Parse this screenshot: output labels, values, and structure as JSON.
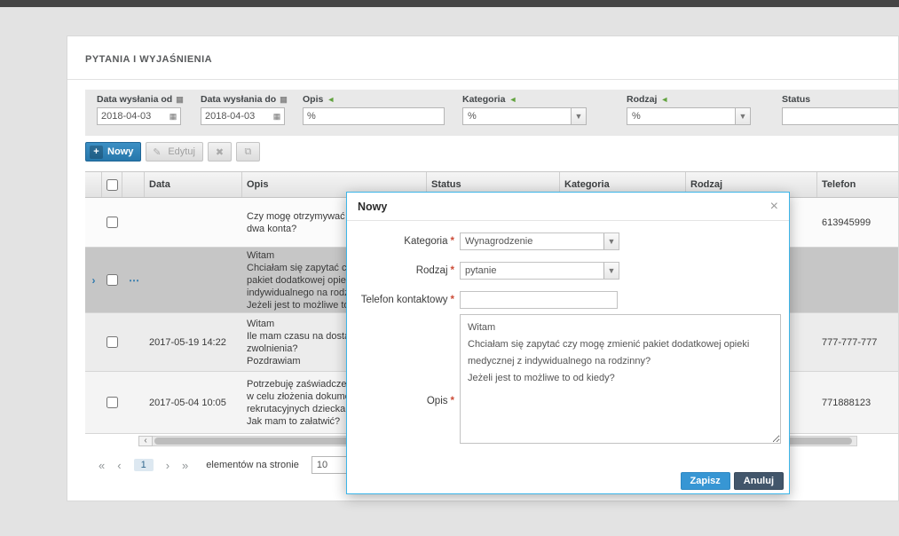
{
  "title": "PYTANIA I WYJAŚNIENIA",
  "icons": {
    "plus": "+",
    "pencil": "✎",
    "delete": "✖",
    "copy": "⧉",
    "calendar": "▦",
    "chevron": "▼",
    "green_filter": "◄",
    "expand": "›",
    "more": "⋯"
  },
  "filters": [
    {
      "label": "Data wysłania od",
      "value": "2018-04-03"
    },
    {
      "label": "Data wysłania do",
      "value": "2018-04-03"
    },
    {
      "label": "Opis",
      "value": "%"
    },
    {
      "label": "Kategoria",
      "value": "%"
    },
    {
      "label": "Rodzaj",
      "value": "%"
    },
    {
      "label": "Status",
      "value": ""
    }
  ],
  "toolbar": {
    "new": "Nowy",
    "edit": "Edytuj"
  },
  "table": {
    "columns": [
      "Data",
      "Opis",
      "Status",
      "Kategoria",
      "Rodzaj",
      "Telefon"
    ],
    "rows": [
      {
        "date": "",
        "opis": [
          "Czy mogę otrzymywać w",
          "dwa konta?"
        ],
        "telefon": "613945999"
      },
      {
        "date": "",
        "opis": [
          "Witam",
          "Chciałam się zapytać czy",
          "pakiet dodatkowej opieki",
          "indywidualnego na rodzi",
          "Jeżeli jest to możliwe to"
        ],
        "telefon": ""
      },
      {
        "date": "2017-05-19 14:22",
        "opis": [
          "Witam",
          "Ile mam czasu na dostar",
          "zwolnienia?",
          "Pozdrawiam"
        ],
        "telefon": "777-777-777"
      },
      {
        "date": "2017-05-04 10:05",
        "opis": [
          "Potrzebuję zaświadczeni",
          "w celu złożenia dokumen",
          "rekrutacyjnych dziecka d",
          "Jak mam to załatwić?"
        ],
        "telefon": "771888123"
      }
    ]
  },
  "scrollbar": {
    "left_arrow": "‹"
  },
  "pager": {
    "first": "«",
    "prev": "‹",
    "page": "1",
    "next": "›",
    "last": "»",
    "per_page_label": "elementów na stronie",
    "per_page": "10"
  },
  "modal": {
    "title": "Nowy",
    "close": "×",
    "required": "*",
    "fields": {
      "kategoria": {
        "label": "Kategoria",
        "value": "Wynagrodzenie"
      },
      "rodzaj": {
        "label": "Rodzaj",
        "value": "pytanie"
      },
      "telefon": {
        "label": "Telefon kontaktowy",
        "value": ""
      },
      "opis": {
        "label": "Opis",
        "value": "Witam\nChciałam się zapytać czy mogę zmienić pakiet dodatkowej opieki\nmedycznej z indywidualnego na rodzinny?\nJeżeli jest to możliwe to od kiedy?"
      }
    },
    "save": "Zapisz",
    "cancel": "Anuluj"
  }
}
